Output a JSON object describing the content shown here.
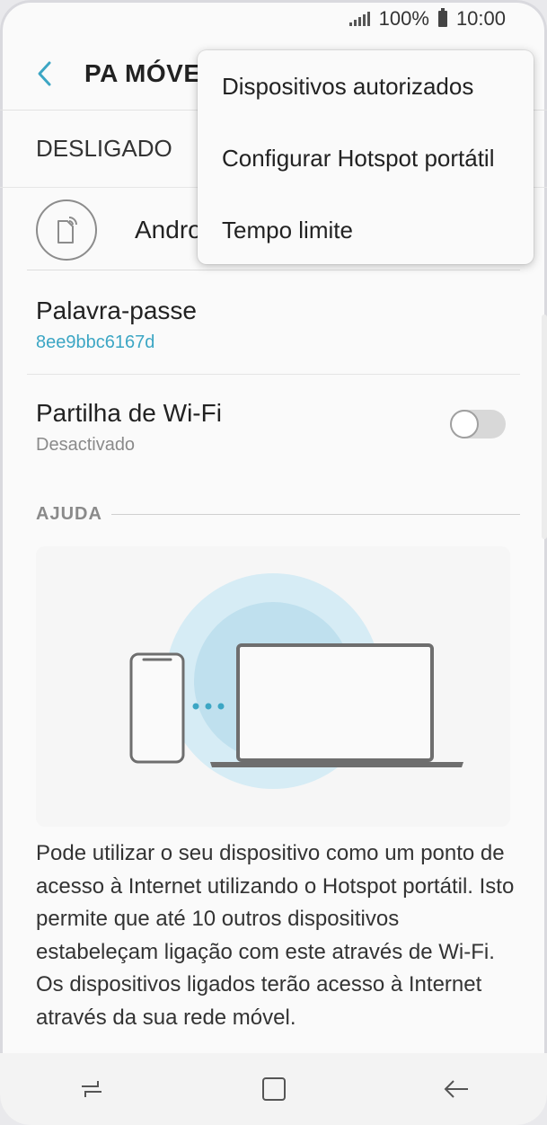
{
  "status_bar": {
    "battery": "100%",
    "time": "10:00"
  },
  "header": {
    "title": "PA MÓVEL"
  },
  "master_switch": {
    "label": "DESLIGADO"
  },
  "device": {
    "name": "Andro"
  },
  "password": {
    "title": "Palavra-passe",
    "value": "8ee9bbc6167d",
    "accent": "#3ca6c4"
  },
  "wifi_sharing": {
    "title": "Partilha de Wi-Fi",
    "status": "Desactivado",
    "enabled": false
  },
  "help": {
    "header": "AJUDA",
    "text": "Pode utilizar o seu dispositivo como um ponto de acesso à Internet utilizando o Hotspot portátil. Isto permite que até 10 outros dispositivos estabeleçam ligação com este através de Wi-Fi. Os dispositivos ligados terão acesso à Internet através da sua rede móvel."
  },
  "menu": {
    "items": [
      {
        "label": "Dispositivos autorizados"
      },
      {
        "label": "Configurar Hotspot portátil"
      },
      {
        "label": "Tempo limite"
      }
    ]
  },
  "nav_icons": [
    "recent-apps-icon",
    "home-icon",
    "back-icon"
  ],
  "colors": {
    "accent": "#3ca6c4",
    "background": "#fafafa",
    "circle_outer": "#d6ecf5",
    "circle_inner": "#bfe0ee"
  }
}
